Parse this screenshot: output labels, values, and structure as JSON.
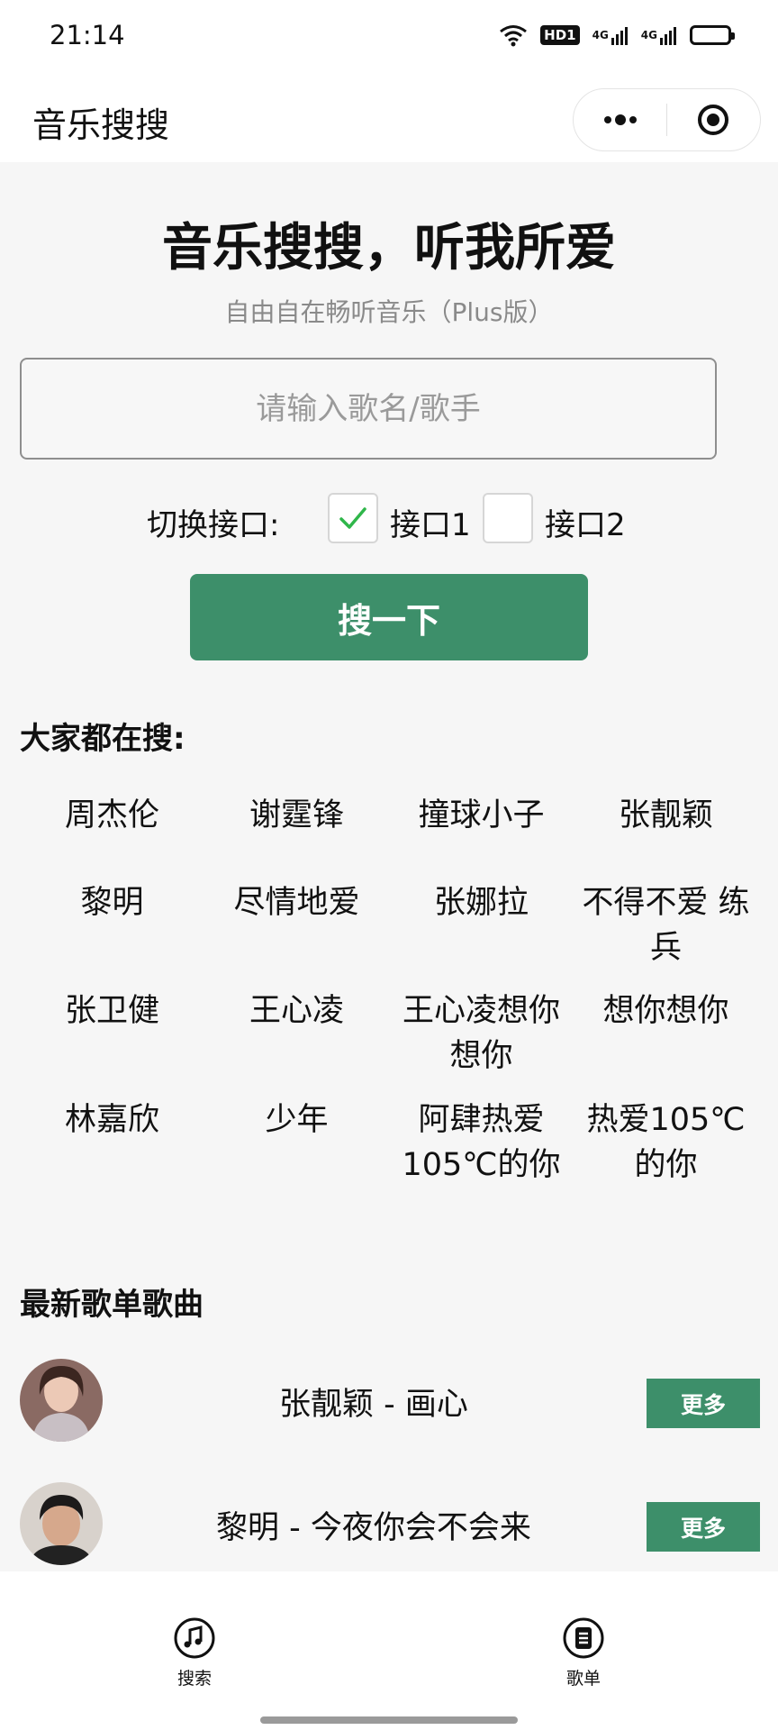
{
  "status_bar": {
    "time": "21:14",
    "hd_badge": "HD1",
    "net1": "4G",
    "net2": "4G",
    "battery_level": 0.85
  },
  "nav": {
    "title": "音乐搜搜",
    "more_icon": "more-dots-icon",
    "close_icon": "target-circle-icon"
  },
  "hero": {
    "title": "音乐搜搜，听我所爱",
    "subtitle": "自由自在畅听音乐（Plus版）"
  },
  "search": {
    "placeholder": "请输入歌名/歌手",
    "value": ""
  },
  "api_switch": {
    "label": "切换接口:",
    "options": [
      {
        "label": "接口1",
        "checked": true
      },
      {
        "label": "接口2",
        "checked": false
      }
    ]
  },
  "search_button": {
    "label": "搜一下"
  },
  "hot": {
    "title": "大家都在搜:",
    "items": [
      "周杰伦",
      "谢霆锋",
      "撞球小子",
      "张靓颖",
      "黎明",
      "尽情地爱",
      "张娜拉",
      "不得不爱 练兵",
      "张卫健",
      "王心凌",
      "王心凌想你想你",
      "想你想你",
      "林嘉欣",
      "少年",
      "阿肆热爱105℃的你",
      "热爱105℃的你"
    ]
  },
  "playlist": {
    "title": "最新歌单歌曲",
    "songs": [
      {
        "name": "张靓颖 - 画心",
        "more": "更多"
      },
      {
        "name": "黎明 - 今夜你会不会来",
        "more": "更多"
      }
    ]
  },
  "tabs": [
    {
      "label": "搜索",
      "icon": "music-note-icon"
    },
    {
      "label": "歌单",
      "icon": "list-icon"
    }
  ],
  "colors": {
    "accent": "#3d8f6a",
    "background": "#f6f6f6",
    "check": "#2fb64a"
  }
}
